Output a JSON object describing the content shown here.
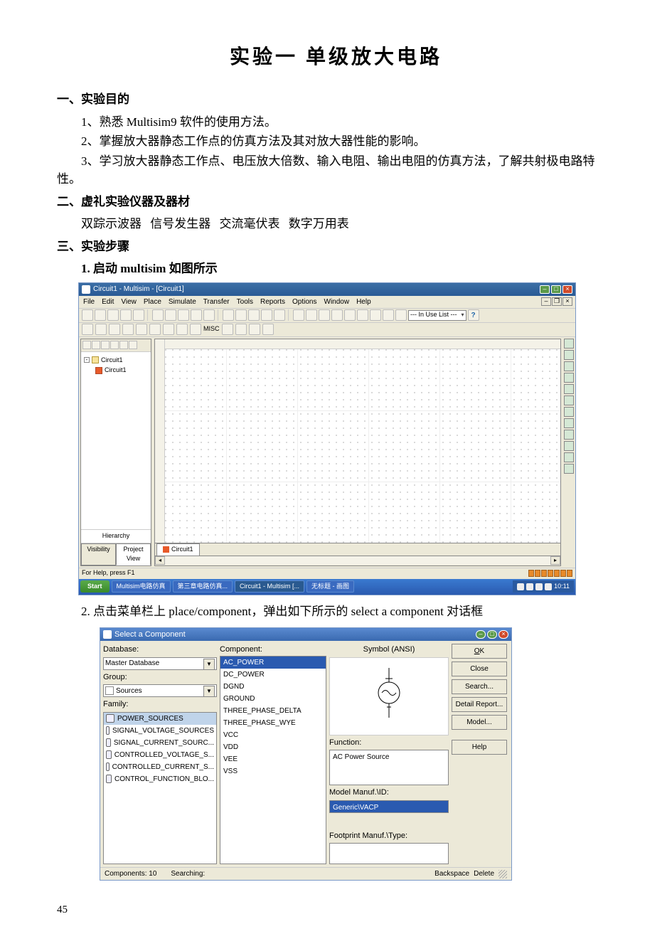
{
  "title": "实验一   单级放大电路",
  "s1": {
    "head": "一、实验目的",
    "i1": "1、熟悉 Multisim9 软件的使用方法。",
    "i2": "2、掌握放大器静态工作点的仿真方法及其对放大器性能的影响。",
    "i3": "3、学习放大器静态工作点、电压放大倍数、输入电阻、输出电阻的仿真方法，了解共射极电路特性。"
  },
  "s2": {
    "head": "二、虚礼实验仪器及器材",
    "items": "双踪示波器      信号发生器      交流毫伏表      数字万用表"
  },
  "s3": {
    "head": "三、实验步骤",
    "step1": "1. 启动 multisim 如图所示",
    "step2": "2. 点击菜单栏上 place/component，弹出如下所示的 select a component 对话框"
  },
  "ms": {
    "title": "Circuit1 - Multisim - [Circuit1]",
    "menus": [
      "File",
      "Edit",
      "View",
      "Place",
      "Simulate",
      "Transfer",
      "Tools",
      "Reports",
      "Options",
      "Window",
      "Help"
    ],
    "combo": "--- In Use List ---",
    "tree_root": "Circuit1",
    "tree_child": "Circuit1",
    "hier": "Hierarchy",
    "tab_vis": "Visibility",
    "tab_proj": "Project View",
    "doc_tab": "Circuit1",
    "status": "For Help, press F1",
    "taskbar": {
      "start": "Start",
      "items": [
        "Multisim电路仿真",
        "第三章电路仿真...",
        "Circuit1 - Multisim [...",
        "无标题 - 画图"
      ],
      "clock": "10:11"
    }
  },
  "sc": {
    "title": "Select a Component",
    "db_label": "Database:",
    "db_value": "Master Database",
    "grp_label": "Group:",
    "grp_value": "Sources",
    "fam_label": "Family:",
    "families": [
      "POWER_SOURCES",
      "SIGNAL_VOLTAGE_SOURCES",
      "SIGNAL_CURRENT_SOURC...",
      "CONTROLLED_VOLTAGE_S...",
      "CONTROLLED_CURRENT_S...",
      "CONTROL_FUNCTION_BLO..."
    ],
    "comp_label": "Component:",
    "components": [
      "AC_POWER",
      "DC_POWER",
      "DGND",
      "GROUND",
      "THREE_PHASE_DELTA",
      "THREE_PHASE_WYE",
      "VCC",
      "VDD",
      "VEE",
      "VSS"
    ],
    "sym_label": "Symbol (ANSI)",
    "func_label": "Function:",
    "func_value": "AC Power Source",
    "model_label": "Model Manuf.\\ID:",
    "model_value": "Generic\\VACP",
    "foot_label": "Footprint Manuf.\\Type:",
    "btns": {
      "ok": "OK",
      "close": "Close",
      "search": "Search...",
      "detail": "Detail Report...",
      "model": "Model...",
      "help": "Help"
    },
    "status_l": "Components: 10",
    "status_m": "Searching:",
    "status_r1": "Backspace",
    "status_r2": "Delete"
  },
  "page_num": "45"
}
